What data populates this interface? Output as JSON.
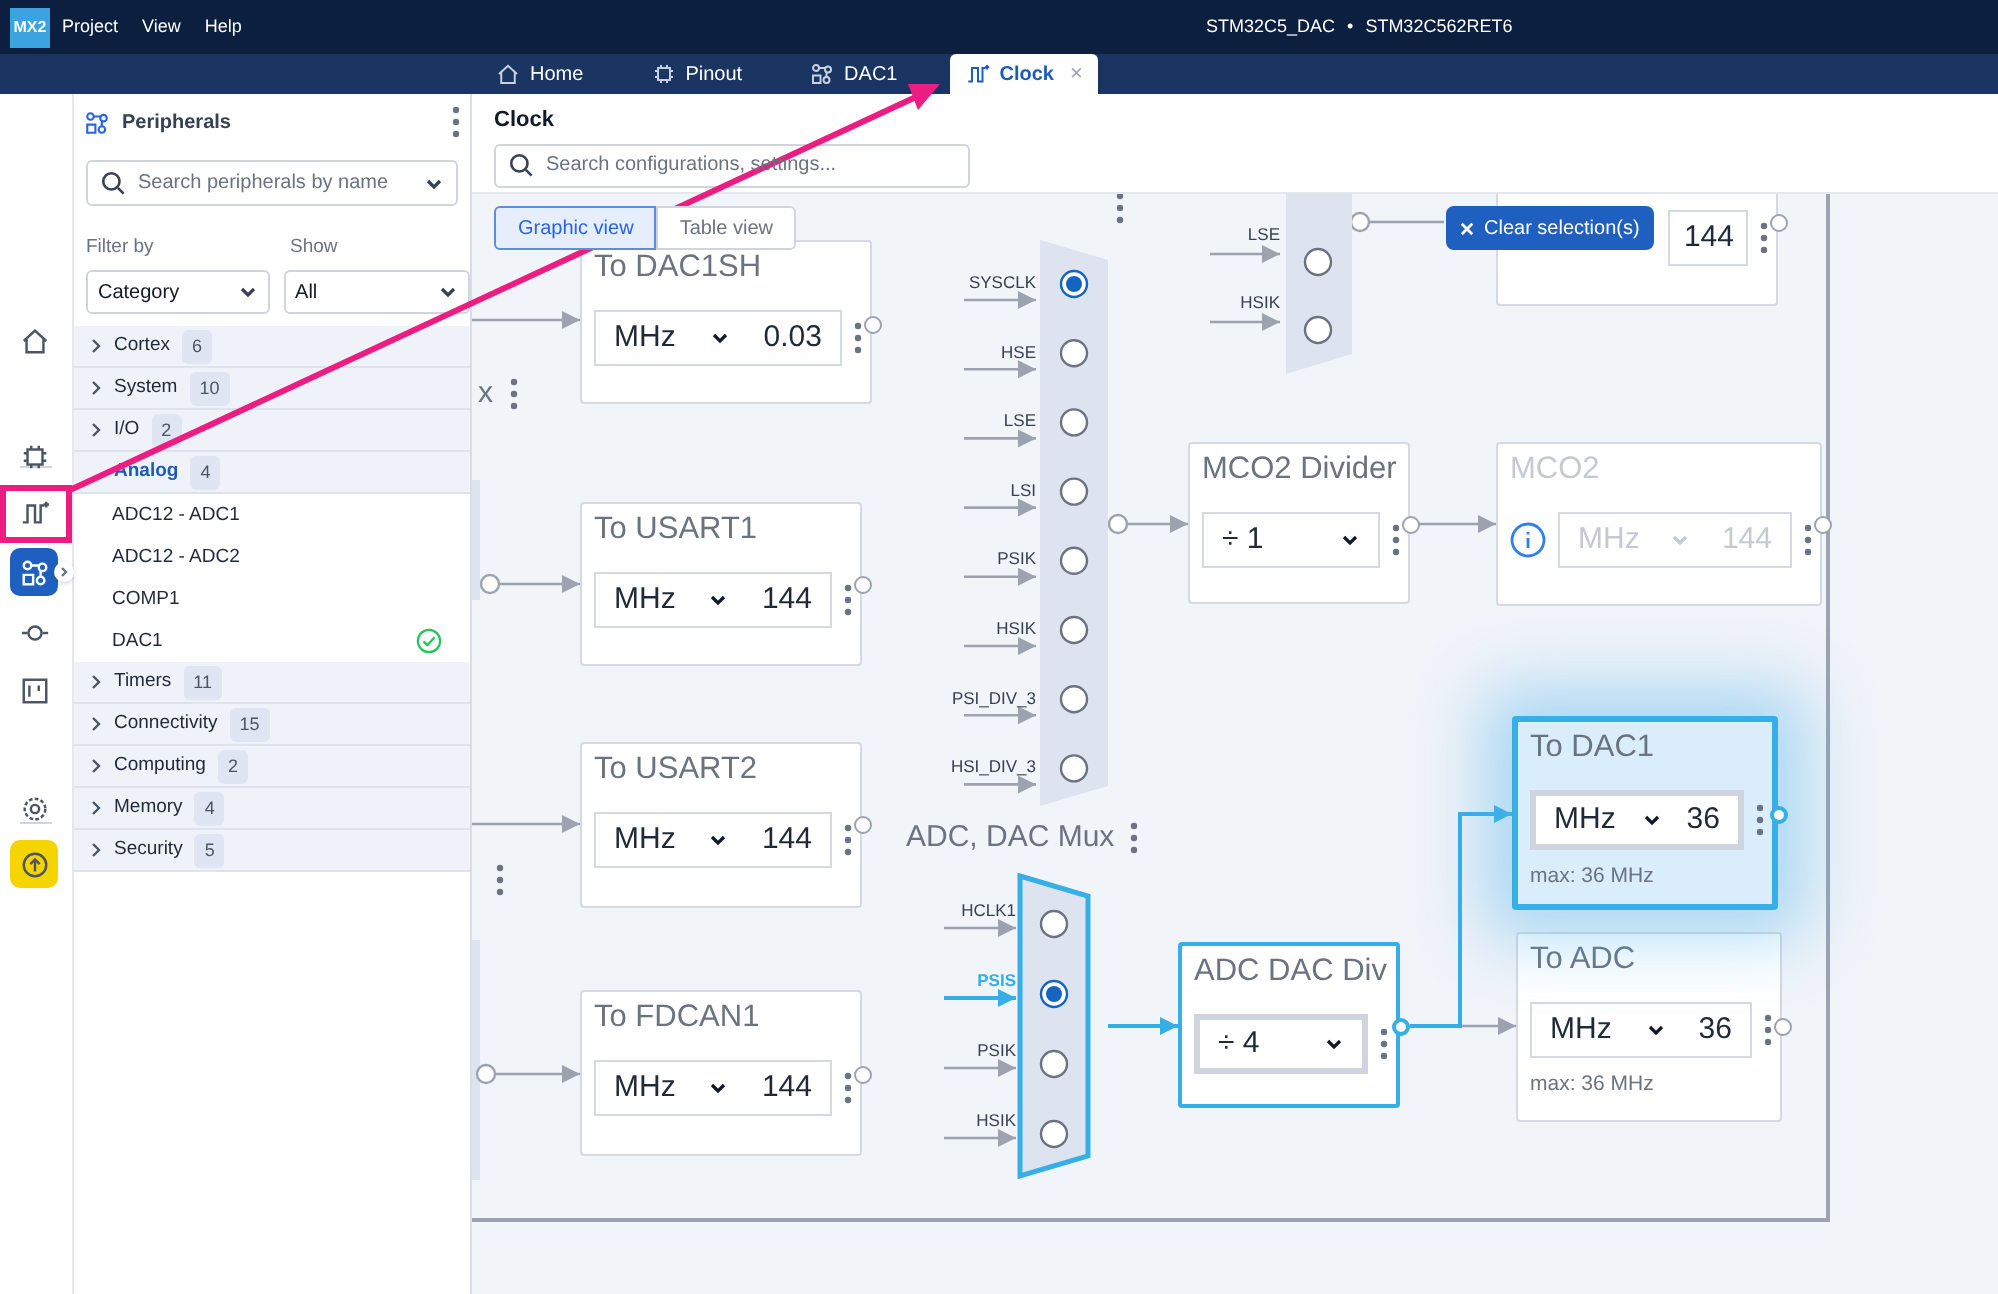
{
  "app": {
    "logo": "MX2",
    "menu": [
      "Project",
      "View",
      "Help"
    ],
    "project": "STM32C5_DAC",
    "separator": "•",
    "device": "STM32C562RET6"
  },
  "tabs": [
    {
      "label": "Home",
      "kind": "home",
      "selected": false
    },
    {
      "label": "Pinout",
      "kind": "chip",
      "selected": false
    },
    {
      "label": "DAC1",
      "kind": "peripherals",
      "selected": false
    },
    {
      "label": "Clock",
      "kind": "clock",
      "selected": true,
      "close": "×"
    }
  ],
  "rail": [
    {
      "kind": "home",
      "selected": false
    },
    {
      "kind": "chip",
      "selected": false
    },
    {
      "kind": "clock",
      "selected": false
    },
    {
      "kind": "peripherals",
      "selected": true
    },
    {
      "kind": "connector",
      "selected": false
    },
    {
      "kind": "board",
      "selected": false
    },
    {
      "kind": "settings",
      "selected": false
    },
    {
      "kind": "upload",
      "selected": false
    }
  ],
  "peripherals": {
    "title": "Peripherals",
    "search_placeholder": "Search peripherals by name",
    "filter_label": "Filter by",
    "filter_value": "Category",
    "show_label": "Show",
    "show_value": "All",
    "categories": [
      {
        "name": "Cortex",
        "count": "6",
        "expanded": false
      },
      {
        "name": "System",
        "count": "10",
        "expanded": false
      },
      {
        "name": "I/O",
        "count": "2",
        "expanded": false
      },
      {
        "name": "Analog",
        "count": "4",
        "expanded": true,
        "children": [
          {
            "name": "ADC12 - ADC1",
            "configured": false
          },
          {
            "name": "ADC12 - ADC2",
            "configured": false
          },
          {
            "name": "COMP1",
            "configured": false
          },
          {
            "name": "DAC1",
            "configured": true
          }
        ]
      },
      {
        "name": "Timers",
        "count": "11",
        "expanded": false
      },
      {
        "name": "Connectivity",
        "count": "15",
        "expanded": false
      },
      {
        "name": "Computing",
        "count": "2",
        "expanded": false
      },
      {
        "name": "Memory",
        "count": "4",
        "expanded": false
      },
      {
        "name": "Security",
        "count": "5",
        "expanded": false
      }
    ]
  },
  "clock": {
    "title": "Clock",
    "search_placeholder": "Search configurations, settings...",
    "views": [
      {
        "label": "Graphic view",
        "selected": true
      },
      {
        "label": "Table view",
        "selected": false
      }
    ],
    "clear_button": "Clear selection(s)",
    "cut_label": "x",
    "nodes": [
      {
        "title": "To DAC1SH",
        "unit": "MHz",
        "value": "0.03",
        "disabled": false,
        "highlighted": false,
        "active": false
      },
      {
        "title": "To USART1",
        "unit": "MHz",
        "value": "144",
        "disabled": false,
        "highlighted": false,
        "active": false
      },
      {
        "title": "To USART2",
        "unit": "MHz",
        "value": "144",
        "disabled": false,
        "highlighted": false,
        "active": false
      },
      {
        "title": "To FDCAN1",
        "unit": "MHz",
        "value": "144",
        "disabled": false,
        "highlighted": false,
        "active": false
      },
      {
        "value": "144",
        "disabled": false,
        "highlighted": false,
        "active": false
      },
      {
        "title": "MCO2 Divider",
        "value": "÷ 1",
        "disabled": false,
        "highlighted": false,
        "active": false
      },
      {
        "title": "MCO2",
        "unit": "MHz",
        "value": "144",
        "disabled": true,
        "highlighted": false,
        "active": false
      },
      {
        "title": "ADC DAC Div",
        "value": "÷ 4",
        "disabled": false,
        "highlighted": false,
        "active": true
      },
      {
        "title": "To DAC1",
        "unit": "MHz",
        "value": "36",
        "max": "max: 36 MHz",
        "disabled": false,
        "highlighted": true,
        "active": true
      },
      {
        "title": "To ADC",
        "unit": "MHz",
        "value": "36",
        "max": "max: 36 MHz",
        "disabled": false,
        "highlighted": false,
        "active": false
      }
    ],
    "muxes": [
      {
        "active": false,
        "inputs": [
          {
            "label": "LSE",
            "selected": false
          },
          {
            "label": "HSIK",
            "selected": false
          }
        ]
      },
      {
        "active": false,
        "inputs": [
          {
            "label": "SYSCLK",
            "selected": true
          },
          {
            "label": "HSE",
            "selected": false
          },
          {
            "label": "LSE",
            "selected": false
          },
          {
            "label": "LSI",
            "selected": false
          },
          {
            "label": "PSIK",
            "selected": false
          },
          {
            "label": "HSIK",
            "selected": false
          },
          {
            "label": "PSI_DIV_3",
            "selected": false
          },
          {
            "label": "HSI_DIV_3",
            "selected": false
          }
        ]
      },
      {
        "title": "ADC, DAC Mux",
        "active": true,
        "inputs": [
          {
            "label": "HCLK1",
            "selected": false
          },
          {
            "label": "PSIS",
            "selected": true
          },
          {
            "label": "PSIK",
            "selected": false
          },
          {
            "label": "HSIK",
            "selected": false
          }
        ]
      }
    ]
  }
}
